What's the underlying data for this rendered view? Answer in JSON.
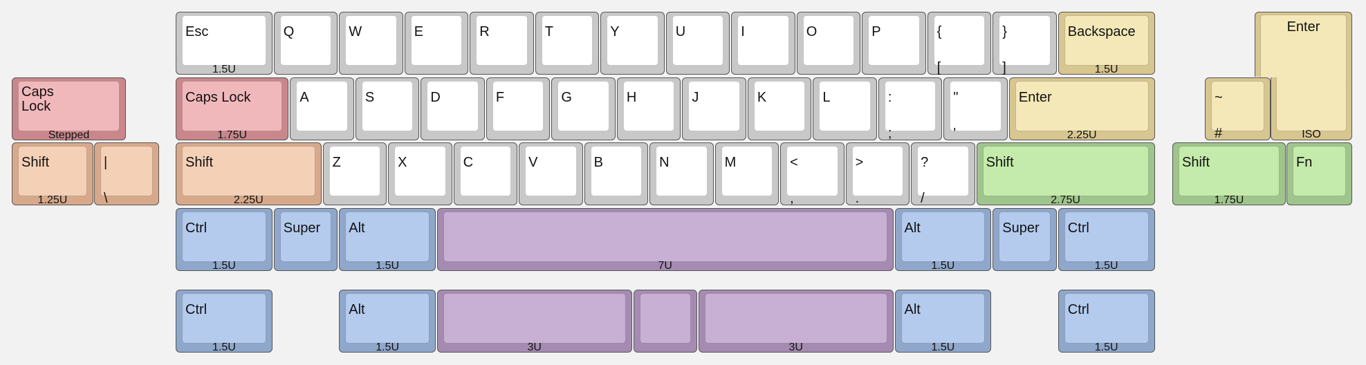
{
  "colors": {
    "grey": {
      "side": "#c8c8c8",
      "top": "#ffffff"
    },
    "yellow": {
      "side": "#d8c690",
      "top": "#f5e8b8"
    },
    "red": {
      "side": "#c9878b",
      "top": "#f1b8bb"
    },
    "peach": {
      "side": "#d7a98a",
      "top": "#f4d0b6"
    },
    "green": {
      "side": "#9fc58c",
      "top": "#c4ebab"
    },
    "blue": {
      "side": "#8fa7ca",
      "top": "#b4cbee"
    },
    "purple": {
      "side": "#a58bb2",
      "top": "#c8b0d4"
    }
  },
  "keys": [
    {
      "color": "grey",
      "labels": [
        "Esc"
      ],
      "legend": "1.5U"
    },
    {
      "color": "grey",
      "labels": [
        "Q"
      ]
    },
    {
      "color": "grey",
      "labels": [
        "W"
      ]
    },
    {
      "color": "grey",
      "labels": [
        "E"
      ]
    },
    {
      "color": "grey",
      "labels": [
        "R"
      ]
    },
    {
      "color": "grey",
      "labels": [
        "T"
      ]
    },
    {
      "color": "grey",
      "labels": [
        "Y"
      ]
    },
    {
      "color": "grey",
      "labels": [
        "U"
      ]
    },
    {
      "color": "grey",
      "labels": [
        "I"
      ]
    },
    {
      "color": "grey",
      "labels": [
        "O"
      ]
    },
    {
      "color": "grey",
      "labels": [
        "P"
      ]
    },
    {
      "color": "grey",
      "labels": [
        "{",
        "["
      ]
    },
    {
      "color": "grey",
      "labels": [
        "}",
        "]"
      ]
    },
    {
      "color": "yellow",
      "labels": [
        "Backspace"
      ],
      "legend": "1.5U"
    },
    {
      "color": "red",
      "labels": [
        "Caps\nLock"
      ],
      "legend": "Stepped"
    },
    {
      "color": "red",
      "labels": [
        "Caps Lock"
      ],
      "legend": "1.75U"
    },
    {
      "color": "grey",
      "labels": [
        "A"
      ]
    },
    {
      "color": "grey",
      "labels": [
        "S"
      ]
    },
    {
      "color": "grey",
      "labels": [
        "D"
      ]
    },
    {
      "color": "grey",
      "labels": [
        "F"
      ]
    },
    {
      "color": "grey",
      "labels": [
        "G"
      ]
    },
    {
      "color": "grey",
      "labels": [
        "H"
      ]
    },
    {
      "color": "grey",
      "labels": [
        "J"
      ]
    },
    {
      "color": "grey",
      "labels": [
        "K"
      ]
    },
    {
      "color": "grey",
      "labels": [
        "L"
      ]
    },
    {
      "color": "grey",
      "labels": [
        ":",
        ";"
      ]
    },
    {
      "color": "grey",
      "labels": [
        "\"",
        "'"
      ]
    },
    {
      "color": "yellow",
      "labels": [
        "Enter"
      ],
      "legend": "2.25U"
    },
    {
      "color": "yellow",
      "labels": [
        "~",
        "#"
      ]
    },
    {
      "color": "peach",
      "labels": [
        "Shift"
      ],
      "legend": "1.25U"
    },
    {
      "color": "peach",
      "labels": [
        "|",
        "\\"
      ]
    },
    {
      "color": "peach",
      "labels": [
        "Shift"
      ],
      "legend": "2.25U"
    },
    {
      "color": "grey",
      "labels": [
        "Z"
      ]
    },
    {
      "color": "grey",
      "labels": [
        "X"
      ]
    },
    {
      "color": "grey",
      "labels": [
        "C"
      ]
    },
    {
      "color": "grey",
      "labels": [
        "V"
      ]
    },
    {
      "color": "grey",
      "labels": [
        "B"
      ]
    },
    {
      "color": "grey",
      "labels": [
        "N"
      ]
    },
    {
      "color": "grey",
      "labels": [
        "M"
      ]
    },
    {
      "color": "grey",
      "labels": [
        "<",
        ","
      ]
    },
    {
      "color": "grey",
      "labels": [
        ">",
        "."
      ]
    },
    {
      "color": "grey",
      "labels": [
        "?",
        "/"
      ]
    },
    {
      "color": "green",
      "labels": [
        "Shift"
      ],
      "legend": "2.75U"
    },
    {
      "color": "green",
      "labels": [
        "Shift"
      ],
      "legend": "1.75U"
    },
    {
      "color": "green",
      "labels": [
        "Fn"
      ]
    },
    {
      "color": "blue",
      "labels": [
        "Ctrl"
      ],
      "legend": "1.5U"
    },
    {
      "color": "blue",
      "labels": [
        "Super"
      ]
    },
    {
      "color": "blue",
      "labels": [
        "Alt"
      ],
      "legend": "1.5U"
    },
    {
      "color": "purple",
      "labels": [],
      "legend": "7U"
    },
    {
      "color": "blue",
      "labels": [
        "Alt"
      ],
      "legend": "1.5U"
    },
    {
      "color": "blue",
      "labels": [
        "Super"
      ]
    },
    {
      "color": "blue",
      "labels": [
        "Ctrl"
      ],
      "legend": "1.5U"
    },
    {
      "color": "blue",
      "labels": [
        "Ctrl"
      ],
      "legend": "1.5U"
    },
    {
      "color": "blue",
      "labels": [
        "Alt"
      ],
      "legend": "1.5U"
    },
    {
      "color": "purple",
      "labels": [],
      "legend": "3U"
    },
    {
      "color": "purple",
      "labels": []
    },
    {
      "color": "purple",
      "labels": [],
      "legend": "3U"
    },
    {
      "color": "blue",
      "labels": [
        "Alt"
      ],
      "legend": "1.5U"
    },
    {
      "color": "blue",
      "labels": [
        "Ctrl"
      ],
      "legend": "1.5U"
    }
  ],
  "iso_enter": {
    "color": "yellow",
    "label": "Enter",
    "legend": "ISO"
  }
}
